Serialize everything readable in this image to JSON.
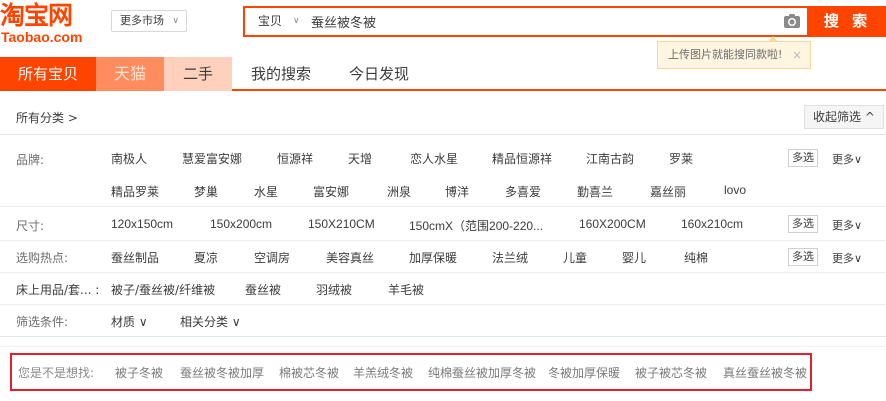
{
  "logo": {
    "cn": "淘宝网",
    "en": "Taobao.com"
  },
  "market": {
    "label": "更多市场",
    "chevron": "chevron-down-icon"
  },
  "search": {
    "type_label": "宝贝",
    "query": "蚕丝被冬被",
    "button_label": "搜 索",
    "camera_icon": "camera-icon",
    "tooltip": "上传图片就能搜同款啦!",
    "tooltip_close": "×"
  },
  "tabs": [
    {
      "label": "所有宝贝",
      "active": true
    },
    {
      "label": "天猫"
    },
    {
      "label": "二手"
    },
    {
      "label": "我的搜索"
    },
    {
      "label": "今日发现"
    }
  ],
  "breadcrumb": {
    "label": "所有分类 >"
  },
  "collapse_button": "收起筛选 ^",
  "filters": {
    "brand": {
      "label": "品牌:",
      "row1": [
        "南极人",
        "慧爱富安娜",
        "恒源祥",
        "天增",
        "恋人水星",
        "精品恒源祥",
        "江南古韵",
        "罗莱"
      ],
      "row2": [
        "精品罗莱",
        "梦巢",
        "水星",
        "富安娜",
        "洲泉",
        "博洋",
        "多喜爱",
        "勤喜兰",
        "嘉丝丽",
        "lovo"
      ],
      "multi": "多选",
      "more": "更多∨"
    },
    "size": {
      "label": "尺寸:",
      "values": [
        "120x150cm",
        "150x200cm",
        "150X210CM",
        "150cmX（范围200-220...",
        "160X200CM",
        "160x210cm"
      ],
      "multi": "多选",
      "more": "更多∨"
    },
    "hot": {
      "label": "选购热点:",
      "values": [
        "蚕丝制品",
        "夏凉",
        "空调房",
        "美容真丝",
        "加厚保暖",
        "法兰绒",
        "儿童",
        "婴儿",
        "纯棉"
      ],
      "multi": "多选",
      "more": "更多∨"
    },
    "bedding": {
      "label": "床上用品/套... :",
      "values": [
        "被子/蚕丝被/纤维被",
        "蚕丝被",
        "羽绒被",
        "羊毛被"
      ]
    },
    "conditions": {
      "label": "筛选条件:",
      "values": [
        "材质 ∨",
        "相关分类 ∨"
      ]
    }
  },
  "suggestions": {
    "label": "您是不是想找:",
    "items": [
      "被子冬被",
      "蚕丝被冬被加厚",
      "棉被芯冬被",
      "羊羔绒冬被",
      "纯棉蚕丝被加厚冬被",
      "冬被加厚保暖",
      "被子被芯冬被",
      "真丝蚕丝被冬被"
    ]
  },
  "colors": {
    "brand_orange": "#ff4400",
    "highlight_red": "#e61e2e"
  }
}
